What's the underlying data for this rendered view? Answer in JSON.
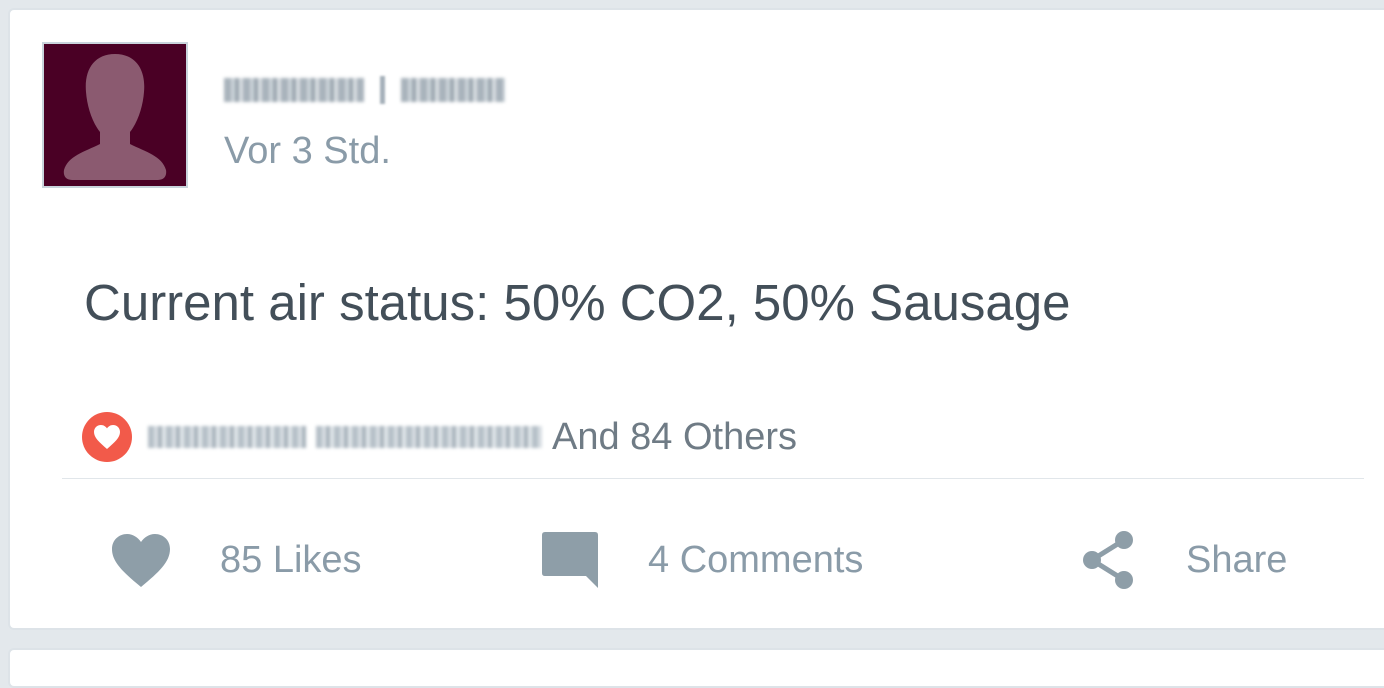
{
  "post": {
    "timestamp": "Vor 3 Std.",
    "text": "Current air status: 50% CO2, 50% Sausage"
  },
  "likes_summary": {
    "others_text": "And 84 Others"
  },
  "actions": {
    "like_label": "85 Likes",
    "comment_label": "4 Comments",
    "share_label": "Share"
  },
  "icons": {
    "avatar": "default-profile-silhouette",
    "liked_badge": "heart-icon",
    "like": "heart-icon",
    "comment": "speech-bubble-icon",
    "share": "share-icon"
  },
  "colors": {
    "avatar_bg": "#4a0025",
    "avatar_silhouette": "#8b5a70",
    "heart_badge": "#f25a4a",
    "icon_gray": "#8e9ea8",
    "post_text": "#434f59",
    "muted_text": "#8a9ba8"
  }
}
